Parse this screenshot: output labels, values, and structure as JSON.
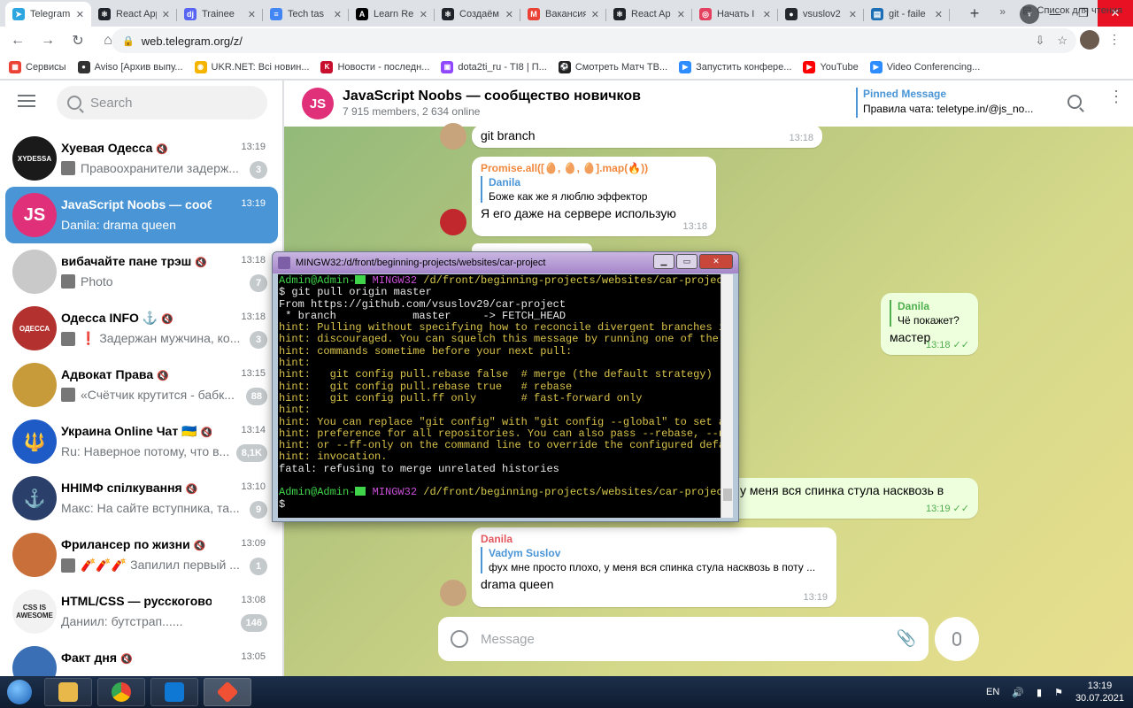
{
  "browser": {
    "tabs": [
      {
        "title": "Telegram",
        "color": "#2ca5e0",
        "glyph": "➤",
        "active": true
      },
      {
        "title": "React App",
        "color": "#20232a",
        "glyph": "⚛"
      },
      {
        "title": "Trainee",
        "color": "#5865f2",
        "glyph": "dj"
      },
      {
        "title": "Tech tas",
        "color": "#4285f4",
        "glyph": "≡"
      },
      {
        "title": "Learn Re",
        "color": "#000000",
        "glyph": "A"
      },
      {
        "title": "Создаём",
        "color": "#20232a",
        "glyph": "⚛"
      },
      {
        "title": "Вакансия",
        "color": "#ea4335",
        "glyph": "M"
      },
      {
        "title": "React Ap",
        "color": "#20232a",
        "glyph": "⚛"
      },
      {
        "title": "Начать I",
        "color": "#e4405f",
        "glyph": "◎"
      },
      {
        "title": "vsuslov2",
        "color": "#24292e",
        "glyph": "●"
      },
      {
        "title": "git - faile",
        "color": "#1c6fb5",
        "glyph": "▤"
      }
    ],
    "url": "web.telegram.org/z/"
  },
  "bookmarks": [
    {
      "label": "Сервисы",
      "color": "#ea4335",
      "glyph": "▦"
    },
    {
      "label": "Aviso [Архив выпу...",
      "color": "#333333",
      "glyph": "●"
    },
    {
      "label": "UKR.NET: Всі новин...",
      "color": "#f5b400",
      "glyph": "◉"
    },
    {
      "label": "Новости - последн...",
      "color": "#c8102e",
      "glyph": "K"
    },
    {
      "label": "dota2ti_ru - TI8 | П...",
      "color": "#9146ff",
      "glyph": "▣"
    },
    {
      "label": "Смотреть Матч ТВ...",
      "color": "#222222",
      "glyph": "⚽"
    },
    {
      "label": "Запустить конфере...",
      "color": "#2d8cff",
      "glyph": "▶"
    },
    {
      "label": "YouTube",
      "color": "#ff0000",
      "glyph": "▶"
    },
    {
      "label": "Video Conferencing...",
      "color": "#2d8cff",
      "glyph": "▶"
    }
  ],
  "reading_list": "Список для чтения",
  "sidebar": {
    "search_placeholder": "Search",
    "chats": [
      {
        "name": "Хуевая Одесса",
        "time": "13:19",
        "preview": "Правоохранители задерж...",
        "badge": "3",
        "color": "#1a1a1a",
        "ava_text": "XYDESSA",
        "thumb": true
      },
      {
        "name": "JavaScript Noobs — сооб...",
        "time": "13:19",
        "preview": "Danila: drama queen",
        "badge": "",
        "color": "#e0307a",
        "ava_text": "JS",
        "active": true
      },
      {
        "name": "вибачайте пане трэш",
        "time": "13:18",
        "preview": "Photo",
        "badge": "7",
        "color": "#c9c9c9",
        "ava_text": "",
        "thumb": true
      },
      {
        "name": "Одесса INFO ⚓",
        "time": "13:18",
        "preview": "❗ Задержан мужчина, ко...",
        "badge": "3",
        "color": "#b3322f",
        "ava_text": "ОДЕССА",
        "thumb": true
      },
      {
        "name": "Адвокат Права",
        "time": "13:15",
        "preview": "«Счётчик крутится - бабк...",
        "badge": "88",
        "color": "#c79a3a",
        "ava_text": "",
        "thumb": true
      },
      {
        "name": "Украина Online Чат 🇺🇦",
        "time": "13:14",
        "preview": "Ru: Наверное потому, что в...",
        "badge": "8,1K",
        "color": "#1e5bc6",
        "ava_text": "🔱"
      },
      {
        "name": "ННІМФ спілкування",
        "time": "13:10",
        "preview": "Макс: На сайте вступника, та...",
        "badge": "9",
        "color": "#2b3f6b",
        "ava_text": "⚓"
      },
      {
        "name": "Фрилансер по жизни",
        "time": "13:09",
        "preview": "🧨🧨🧨 Запилил первый ...",
        "badge": "1",
        "color": "#c96f3a",
        "ava_text": "",
        "thumb": true
      },
      {
        "name": "HTML/CSS — русскогово...",
        "time": "13:08",
        "preview": "Даниил: бутстрап......",
        "badge": "146",
        "color": "#f2f2f2",
        "ava_text": "CSS IS AWESOME"
      },
      {
        "name": "Факт дня",
        "time": "13:05",
        "preview": "",
        "badge": "",
        "color": "#3a6fb5",
        "ava_text": ""
      }
    ]
  },
  "chat": {
    "title": "JavaScript Noobs — сообщество новичков",
    "subtitle": "7 915 members, 2 634 online",
    "avatar_text": "JS",
    "pinned_label": "Pinned Message",
    "pinned_text": "Правила чата: teletype.in/@js_no...",
    "messages": {
      "m1_text": "git branch",
      "m1_time": "13:18",
      "m2_sender": "Promise.all([🥚, 🥚, 🥚].map(🔥))",
      "m2_reply_name": "Danila",
      "m2_reply_text": "Боже как же я люблю эффектор",
      "m2_text": "Я его даже на сервере использую",
      "m2_time": "13:18",
      "m3_reply_name": "Danila",
      "m3_reply_text": "Чё покажет?",
      "m3_text": "мастер",
      "m3_time": "13:18",
      "m4_text": "у меня вся спинка стула насквозь в",
      "m4_time": "13:19",
      "m5_sender": "Danila",
      "m5_reply_name": "Vadym Suslov",
      "m5_reply_text": "фух мне просто плохо, у меня вся спинка стула насквозь в поту ...",
      "m5_text": "drama queen",
      "m5_time": "13:19"
    },
    "composer_placeholder": "Message"
  },
  "terminal": {
    "title": "MINGW32:/d/front/beginning-projects/websites/car-project",
    "prompt_user": "Admin@Admin-",
    "prompt_env": "MINGW32",
    "prompt_path": "/d/front/beginning-projects/websites/car-projec",
    "lines": [
      "$ git pull origin master",
      "From https://github.com/vsuslov29/car-project",
      " * branch            master     -> FETCH_HEAD",
      "hint: Pulling without specifying how to reconcile divergent branches i",
      "hint: discouraged. You can squelch this message by running one of the",
      "hint: commands sometime before your next pull:",
      "hint:",
      "hint:   git config pull.rebase false  # merge (the default strategy)",
      "hint:   git config pull.rebase true   # rebase",
      "hint:   git config pull.ff only       # fast-forward only",
      "hint:",
      "hint: You can replace \"git config\" with \"git config --global\" to set a",
      "hint: preference for all repositories. You can also pass --rebase, --n",
      "hint: or --ff-only on the command line to override the configured defa",
      "hint: invocation.",
      "fatal: refusing to merge unrelated histories"
    ],
    "final_prompt": "$"
  },
  "taskbar": {
    "lang": "EN",
    "time": "13:19",
    "date": "30.07.2021"
  }
}
